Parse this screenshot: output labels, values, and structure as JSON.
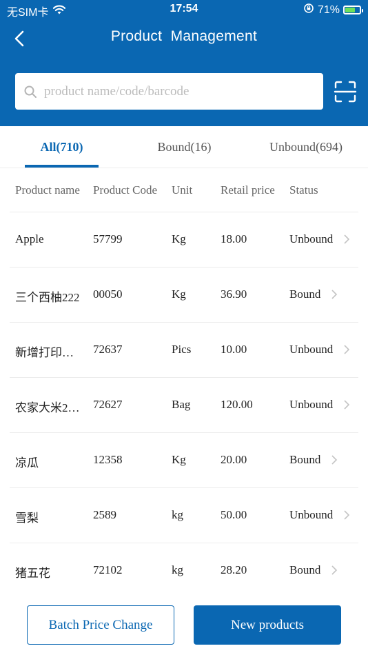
{
  "status_bar": {
    "carrier": "无SIM卡",
    "time": "17:54",
    "battery_percent": "71%",
    "icons": [
      "wifi-icon",
      "orientation-lock-icon",
      "battery-icon"
    ]
  },
  "header": {
    "title": "Product  Management",
    "back_icon": "chevron-left-icon"
  },
  "search": {
    "placeholder": "product name/code/barcode",
    "value": "",
    "scan_icon": "scan-icon"
  },
  "tabs": [
    {
      "label": "All(710)",
      "active": true
    },
    {
      "label": "Bound(16)",
      "active": false
    },
    {
      "label": "Unbound(694)",
      "active": false
    }
  ],
  "table": {
    "headers": [
      "Product name",
      "Product Code",
      "Unit",
      "Retail price",
      "Status"
    ],
    "rows": [
      {
        "name": "Apple",
        "code": "57799",
        "unit": "Kg",
        "price": "18.00",
        "status": "Unbound"
      },
      {
        "name": "三个西柚222",
        "code": "00050",
        "unit": "Kg",
        "price": "36.90",
        "status": "Bound"
      },
      {
        "name": "新增打印…",
        "code": "72637",
        "unit": "Pics",
        "price": "10.00",
        "status": "Unbound"
      },
      {
        "name": "农家大米2…",
        "code": "72627",
        "unit": "Bag",
        "price": "120.00",
        "status": "Unbound"
      },
      {
        "name": "凉瓜",
        "code": "12358",
        "unit": "Kg",
        "price": "20.00",
        "status": "Bound"
      },
      {
        "name": "雪梨",
        "code": "2589",
        "unit": "kg",
        "price": "50.00",
        "status": "Unbound"
      },
      {
        "name": "猪五花",
        "code": "72102",
        "unit": "kg",
        "price": "28.20",
        "status": "Bound"
      }
    ]
  },
  "actions": {
    "batch_label": "Batch Price Change",
    "new_label": "New products"
  },
  "colors": {
    "brand": "#0a67b2",
    "battery": "#6ee05a"
  }
}
